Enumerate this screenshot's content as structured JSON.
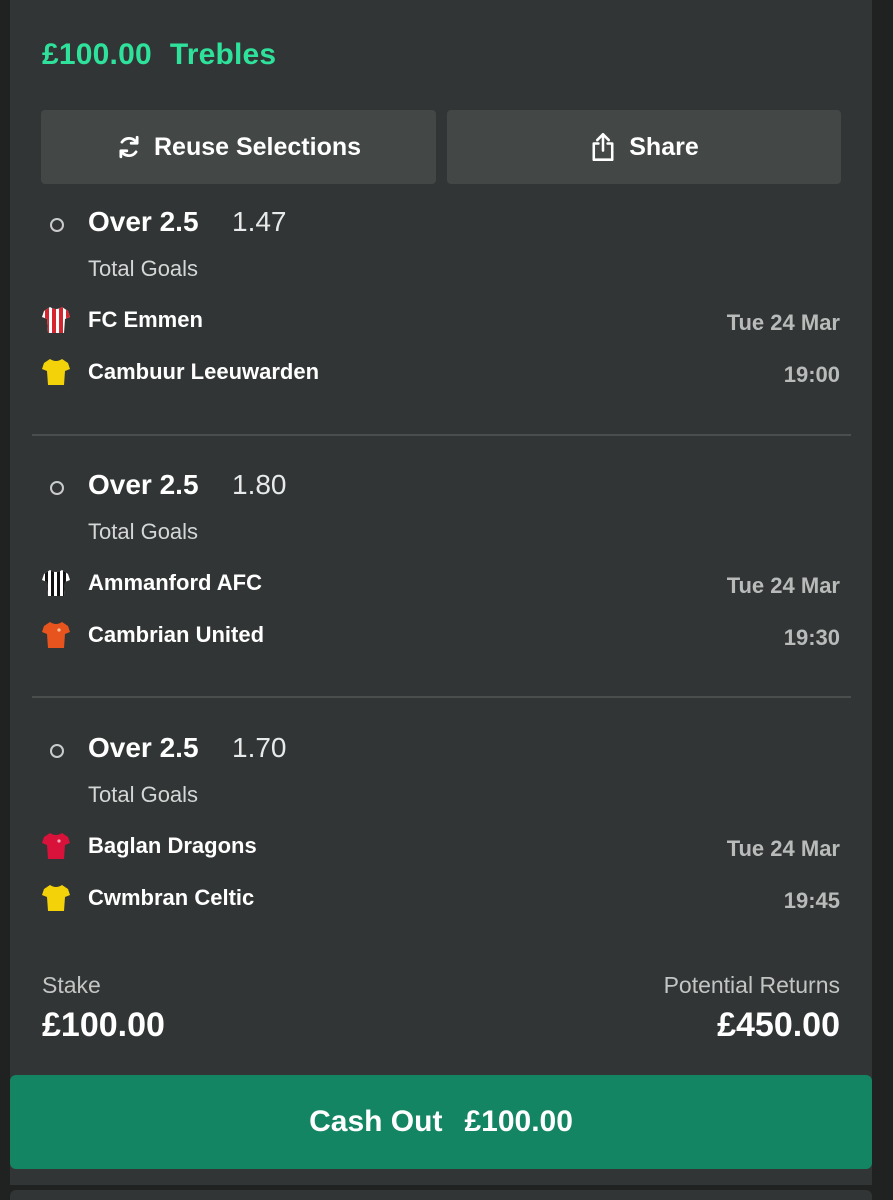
{
  "bet": {
    "amount": "£100.00",
    "type": "Trebles"
  },
  "actions": {
    "reuse_label": "Reuse Selections",
    "share_label": "Share"
  },
  "selections": [
    {
      "pick": "Over 2.5",
      "odds": "1.47",
      "market": "Total Goals",
      "home_team": "FC Emmen",
      "away_team": "Cambuur Leeuwarden",
      "date": "Tue 24 Mar",
      "time": "19:00"
    },
    {
      "pick": "Over 2.5",
      "odds": "1.80",
      "market": "Total Goals",
      "home_team": "Ammanford AFC",
      "away_team": "Cambrian United",
      "date": "Tue 24 Mar",
      "time": "19:30"
    },
    {
      "pick": "Over 2.5",
      "odds": "1.70",
      "market": "Total Goals",
      "home_team": "Baglan Dragons",
      "away_team": "Cwmbran Celtic",
      "date": "Tue 24 Mar",
      "time": "19:45"
    }
  ],
  "summary": {
    "stake_label": "Stake",
    "stake_value": "£100.00",
    "returns_label": "Potential Returns",
    "returns_value": "£450.00"
  },
  "cashout": {
    "label": "Cash Out",
    "amount": "£100.00"
  },
  "colors": {
    "accent": "#2ee29b",
    "cashout": "#148563",
    "card": "#323535"
  },
  "icons": {
    "reuse": "refresh-icon",
    "share": "share-icon",
    "kits": [
      "red-white-striped-shirt-icon",
      "yellow-shirt-icon",
      "black-white-striped-shirt-icon",
      "orange-shirt-icon",
      "red-shirt-icon",
      "yellow-shirt-icon"
    ]
  }
}
